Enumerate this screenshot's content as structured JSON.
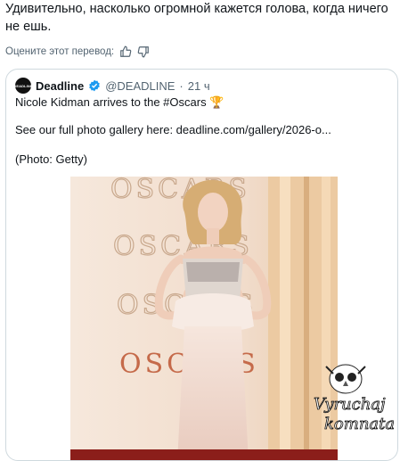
{
  "post": {
    "text": "Удивительно, насколько огромной кажется голова, когда ничего не ешь.",
    "rate_translation": "Оцените этот перевод:"
  },
  "quote": {
    "avatar_text": "DEADLINE",
    "name": "Deadline",
    "handle": "@DEADLINE",
    "separator": "·",
    "time": "21 ч",
    "line1": "Nicole Kidman arrives to the #Oscars 🏆",
    "line2": "See our full photo gallery here: deadline.com/gallery/2026-o...",
    "line3": "(Photo: Getty)"
  },
  "photo": {
    "backdrop_words": [
      "OSCARS",
      "OSCARS",
      "OSCARS",
      "OSCARS"
    ]
  },
  "watermark": {
    "line1": "Vyruchaj",
    "line2": "komnata"
  },
  "colors": {
    "text": "#0f1419",
    "secondary": "#536471",
    "border": "#cfd9de",
    "verified": "#1d9bf0",
    "backdrop": "#f3e4d7",
    "dress": "#f1d9cf"
  },
  "icons": [
    "thumbs-up-icon",
    "thumbs-down-icon",
    "verified-badge-icon",
    "owl-icon"
  ]
}
